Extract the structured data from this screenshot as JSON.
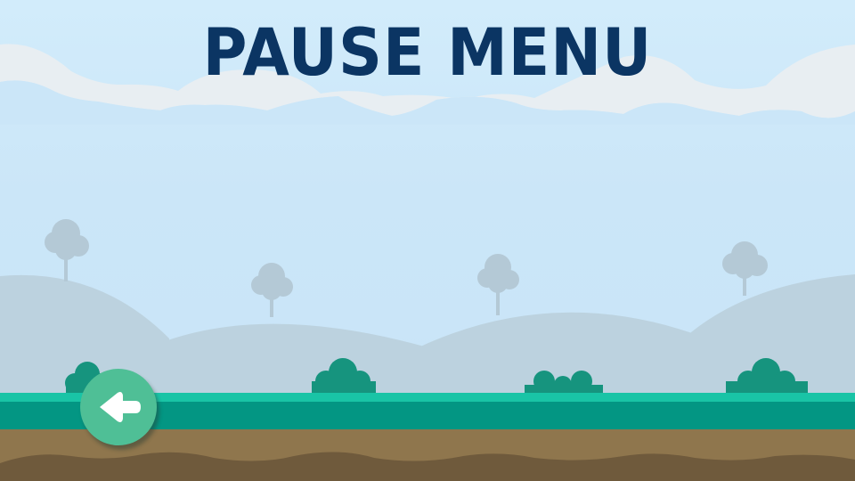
{
  "screen": {
    "title": "PAUSE MENU"
  },
  "back_button": {
    "icon": "arrow-left-icon"
  },
  "colors": {
    "sky": "#cde8f8",
    "clouds": "#e8eef2",
    "hills": "#bcd2df",
    "trees": "#b4c9d6",
    "bushes": "#16947e",
    "grass_top": "#19c4a6",
    "grass": "#039683",
    "dirt": "#8f764d",
    "dirt_dark": "#6f5a3c",
    "title": "#0b3563",
    "button": "#4fbf96"
  }
}
